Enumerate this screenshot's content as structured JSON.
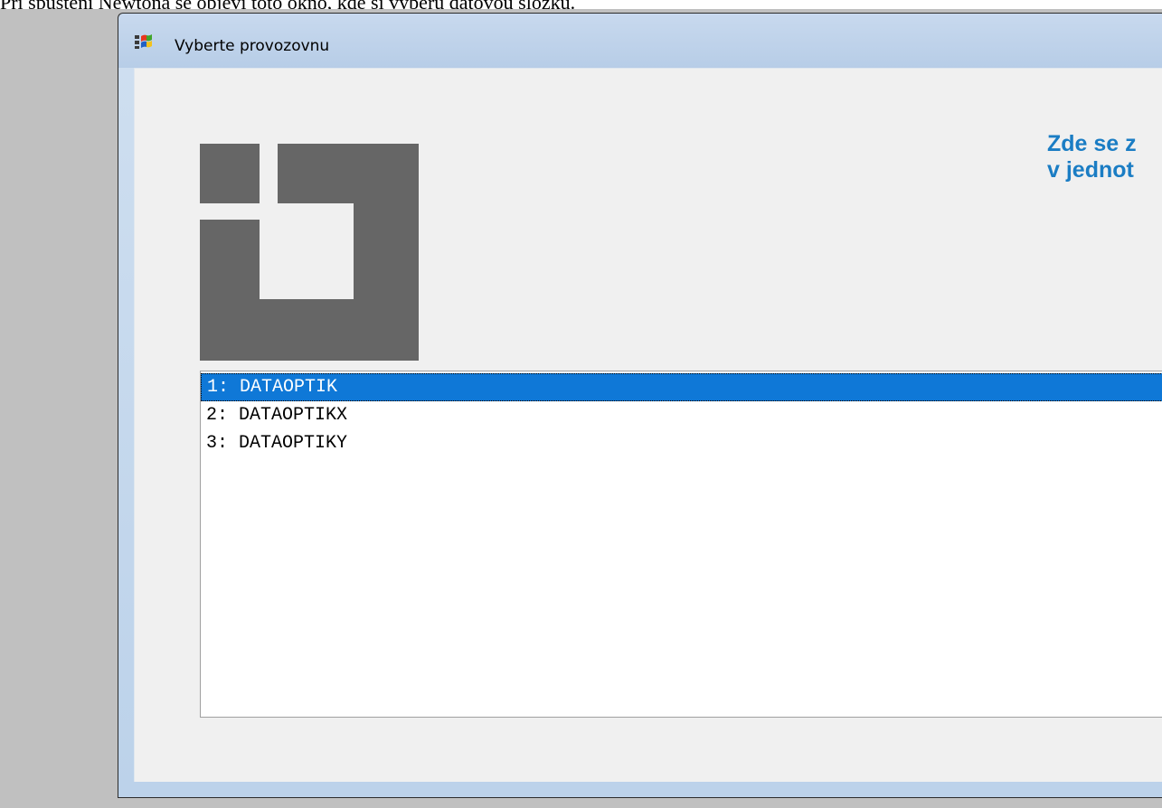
{
  "caption": "Při spuštění Newtona se objeví toto okno, kde si vyberu datovou složku.",
  "window": {
    "title": "Vyberte provozovnu",
    "icon": "windows-app-icon"
  },
  "heading": {
    "line1": "Zde se z",
    "line2": "v jednot"
  },
  "logo": {
    "icon": "company-logo-icon",
    "color": "#666666"
  },
  "list": {
    "items": [
      {
        "label": "1: DATAOPTIK",
        "selected": true
      },
      {
        "label": "2: DATAOPTIKX",
        "selected": false
      },
      {
        "label": "3: DATAOPTIKY",
        "selected": false
      }
    ]
  },
  "colors": {
    "selection": "#0f78d7",
    "heading": "#1b7dc4",
    "background": "#c0c0c0"
  }
}
